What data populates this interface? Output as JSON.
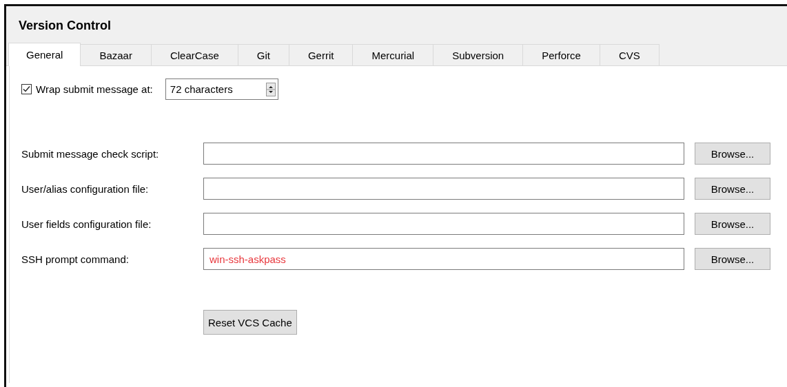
{
  "window": {
    "title": "Version Control"
  },
  "tabs": [
    {
      "label": "General",
      "selected": true
    },
    {
      "label": "Bazaar",
      "selected": false
    },
    {
      "label": "ClearCase",
      "selected": false
    },
    {
      "label": "Git",
      "selected": false
    },
    {
      "label": "Gerrit",
      "selected": false
    },
    {
      "label": "Mercurial",
      "selected": false
    },
    {
      "label": "Subversion",
      "selected": false
    },
    {
      "label": "Perforce",
      "selected": false
    },
    {
      "label": "CVS",
      "selected": false
    }
  ],
  "wrap": {
    "label": "Wrap submit message at:",
    "checked": true,
    "value": "72 characters"
  },
  "fields": [
    {
      "label": "Submit message check script:",
      "button": "Browse..."
    },
    {
      "label": "User/alias configuration file:",
      "button": "Browse..."
    },
    {
      "label": "User fields configuration file:",
      "button": "Browse..."
    },
    {
      "label": "SSH prompt command:",
      "value": "win-ssh-askpass",
      "button": "Browse...",
      "error": true
    }
  ],
  "reset_button": "Reset VCS Cache"
}
